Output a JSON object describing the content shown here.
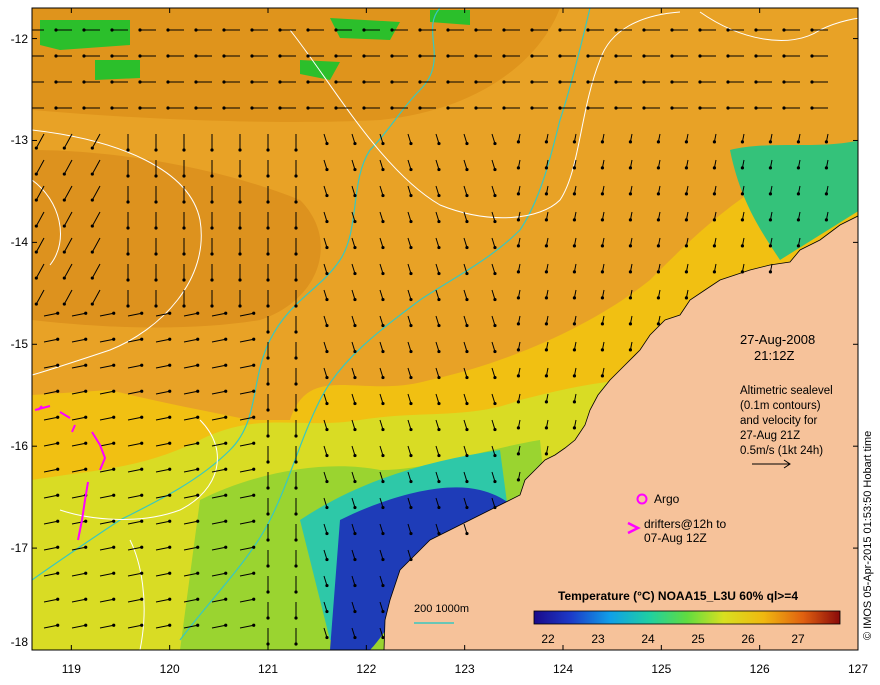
{
  "map": {
    "x_ticks": [
      "119",
      "120",
      "121",
      "122",
      "123",
      "124",
      "125",
      "126",
      "127"
    ],
    "y_ticks": [
      "-12",
      "-13",
      "-14",
      "-15",
      "-16",
      "-17",
      "-18"
    ],
    "lon_range": [
      118.6,
      127
    ],
    "lat_range": [
      -18,
      -11.7
    ]
  },
  "annotations": {
    "date": "27-Aug-2008",
    "time": "21:12Z",
    "legend_lines": [
      "Altimetric sealevel",
      "(0.1m contours)",
      "and velocity for",
      "27-Aug 21Z",
      "0.5m/s (1kt 24h)"
    ],
    "argo_label": "Argo",
    "drifters_line1": "drifters@12h to",
    "drifters_line2": "07-Aug 12Z",
    "depth_label": "200  1000m",
    "credit": "© IMOS 05-Apr-2015 01:53:50 Hobart time"
  },
  "colorbar": {
    "title": "Temperature (°C) NOAA15_L3U 60% ql>=4",
    "ticks": [
      "22",
      "23",
      "24",
      "25",
      "26",
      "27"
    ]
  },
  "colors": {
    "land": "#f6c29a",
    "warm": "#e9a022",
    "ocean_mid": "#f2c010",
    "ocean_cool": "#d6e020",
    "green_cloud": "#2bbf2b",
    "cold": "#1c2aa6",
    "drifter": "#ff00ff",
    "depth_contour": "#38c8c0"
  }
}
